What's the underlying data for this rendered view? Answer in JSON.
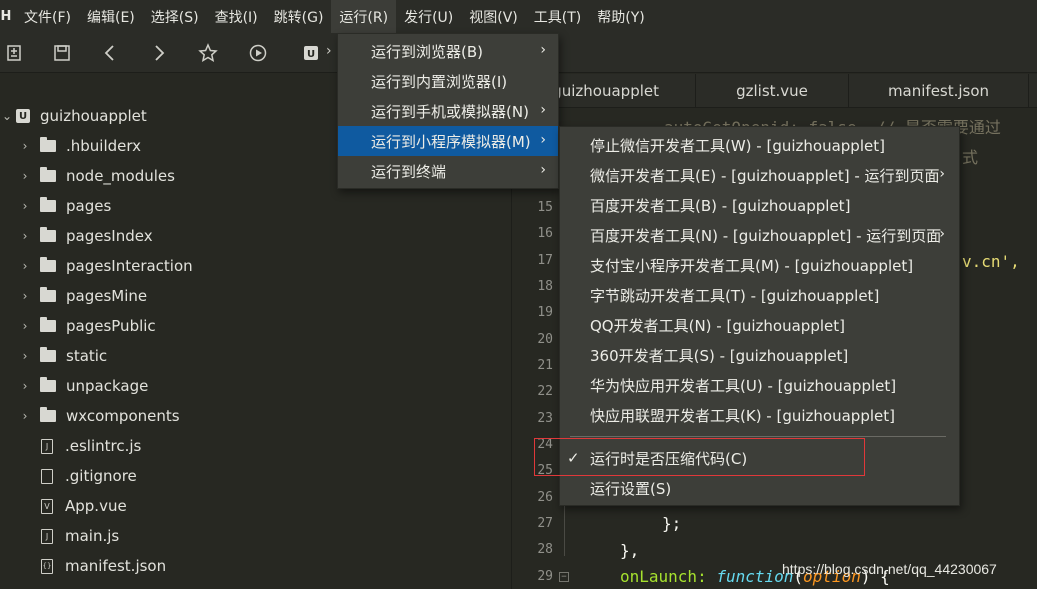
{
  "menubar": {
    "logo": "H",
    "items": [
      "文件(F)",
      "编辑(E)",
      "选择(S)",
      "查找(I)",
      "跳转(G)",
      "运行(R)",
      "发行(U)",
      "视图(V)",
      "工具(T)",
      "帮助(Y)"
    ]
  },
  "toolbar": {
    "icons": [
      "new-file-icon",
      "save-icon",
      "back-icon",
      "forward-icon",
      "star-icon",
      "run-icon",
      "project-icon"
    ],
    "breadcrumb_arrow": "›"
  },
  "sidebar": {
    "project": "guizhouapplet",
    "folders": [
      ".hbuilderx",
      "node_modules",
      "pages",
      "pagesIndex",
      "pagesInteraction",
      "pagesMine",
      "pagesPublic",
      "static",
      "unpackage",
      "wxcomponents"
    ],
    "files": [
      {
        "name": ".eslintrc.js",
        "icon": "js-file-icon",
        "glyph": "J"
      },
      {
        "name": ".gitignore",
        "icon": "file-icon",
        "glyph": ""
      },
      {
        "name": "App.vue",
        "icon": "vue-file-icon",
        "glyph": "V"
      },
      {
        "name": "main.js",
        "icon": "js-file-icon",
        "glyph": "J"
      },
      {
        "name": "manifest.json",
        "icon": "json-file-icon",
        "glyph": "{}"
      }
    ]
  },
  "editor": {
    "tabs": [
      "guizhouapplet",
      "gzlist.vue",
      "manifest.json"
    ],
    "line_numbers": [
      "15",
      "16",
      "17",
      "18",
      "19",
      "20",
      "21",
      "22",
      "23",
      "24",
      "25",
      "26",
      "27",
      "28",
      "29"
    ],
    "code_top_a": "autoGetOpenid: false, // 是否需要通过",
    "code_top_b": "式",
    "code_frag_17": "v.cn',",
    "code_27": "};",
    "code_28": "},",
    "code_29_a": "onLaunch: ",
    "code_29_kw": "function",
    "code_29_b": "(",
    "code_29_param": "option",
    "code_29_c": ") {",
    "fold_marker": "−"
  },
  "run_menu": {
    "items": [
      {
        "label": "运行到浏览器(B)",
        "arrow": "›"
      },
      {
        "label": "运行到内置浏览器(I)",
        "arrow": ""
      },
      {
        "label": "运行到手机或模拟器(N)",
        "arrow": "›"
      },
      {
        "label": "运行到小程序模拟器(M)",
        "arrow": "›"
      },
      {
        "label": "运行到终端",
        "arrow": "›"
      }
    ],
    "selected_index": 3
  },
  "submenu": {
    "items": [
      {
        "label": "停止微信开发者工具(W) - [guizhouapplet]",
        "arrow": ""
      },
      {
        "label": "微信开发者工具(E) - [guizhouapplet] - 运行到页面",
        "arrow": "›"
      },
      {
        "label": "百度开发者工具(B) - [guizhouapplet]",
        "arrow": ""
      },
      {
        "label": "百度开发者工具(N) - [guizhouapplet] - 运行到页面",
        "arrow": "›"
      },
      {
        "label": "支付宝小程序开发者工具(M) - [guizhouapplet]",
        "arrow": ""
      },
      {
        "label": "字节跳动开发者工具(T) - [guizhouapplet]",
        "arrow": ""
      },
      {
        "label": "QQ开发者工具(N) - [guizhouapplet]",
        "arrow": ""
      },
      {
        "label": "360开发者工具(S) - [guizhouapplet]",
        "arrow": ""
      },
      {
        "label": "华为快应用开发者工具(U) - [guizhouapplet]",
        "arrow": ""
      },
      {
        "label": "快应用联盟开发者工具(K) - [guizhouapplet]",
        "arrow": ""
      }
    ],
    "compress": {
      "label": "运行时是否压缩代码(C)",
      "check": "✓"
    },
    "settings": {
      "label": "运行设置(S)"
    }
  },
  "watermark": "https://blog.csdn.net/qq_44230067",
  "colors": {
    "menu_selected": "#0f5aa0",
    "highlight_border": "#e0383a",
    "background": "#272822"
  }
}
